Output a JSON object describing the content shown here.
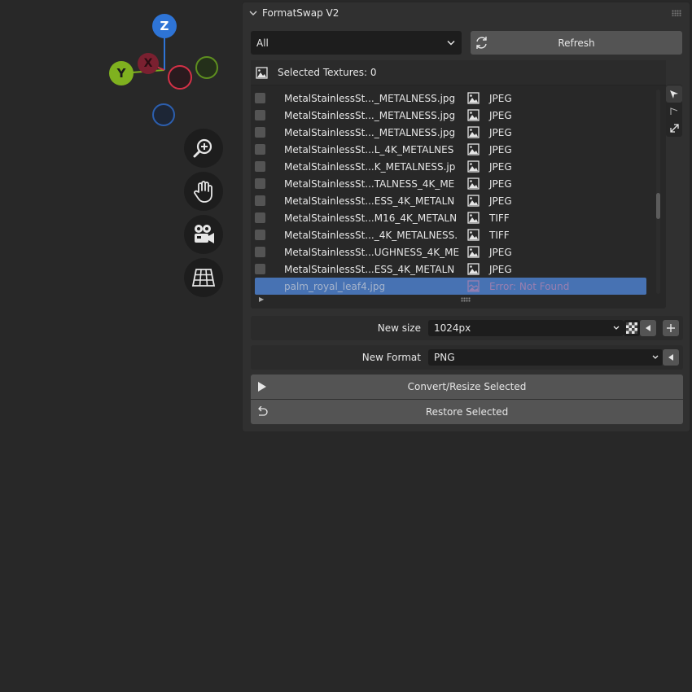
{
  "gizmo": {
    "z_label": "Z",
    "y_label": "Y",
    "x_label": "X"
  },
  "nav_buttons": [
    "zoom-icon",
    "hand-pan-icon",
    "camera-icon",
    "grid-icon"
  ],
  "panel": {
    "title": "FormatSwap V2",
    "filter": {
      "value": "All"
    },
    "refresh_label": "Refresh",
    "list": {
      "header": "Selected Textures: 0",
      "rows": [
        {
          "name": "MetalStainlessSt..._METALNESS.jpg",
          "type": "JPEG"
        },
        {
          "name": "MetalStainlessSt..._METALNESS.jpg",
          "type": "JPEG"
        },
        {
          "name": "MetalStainlessSt..._METALNESS.jpg",
          "type": "JPEG"
        },
        {
          "name": "MetalStainlessSt...L_4K_METALNES",
          "type": "JPEG"
        },
        {
          "name": "MetalStainlessSt...K_METALNESS.jp",
          "type": "JPEG"
        },
        {
          "name": "MetalStainlessSt...TALNESS_4K_ME",
          "type": "JPEG"
        },
        {
          "name": "MetalStainlessSt...ESS_4K_METALN",
          "type": "JPEG"
        },
        {
          "name": "MetalStainlessSt...M16_4K_METALN",
          "type": "TIFF"
        },
        {
          "name": "MetalStainlessSt..._4K_METALNESS.",
          "type": "TIFF"
        },
        {
          "name": "MetalStainlessSt...UGHNESS_4K_ME",
          "type": "JPEG"
        },
        {
          "name": "MetalStainlessSt...ESS_4K_METALN",
          "type": "JPEG"
        }
      ],
      "selected_row": {
        "name": "palm_royal_leaf4.jpg",
        "type": "Error: Not Found"
      }
    },
    "new_size": {
      "label": "New size",
      "value": "1024px"
    },
    "new_format": {
      "label": "New Format",
      "value": "PNG"
    },
    "convert_label": "Convert/Resize Selected",
    "restore_label": "Restore Selected"
  },
  "colors": {
    "background": "#282828",
    "panel": "#303030",
    "selection": "#4772b3",
    "axis_x": "#d53147",
    "axis_y": "#7fb11f",
    "axis_z": "#2e74d6"
  }
}
